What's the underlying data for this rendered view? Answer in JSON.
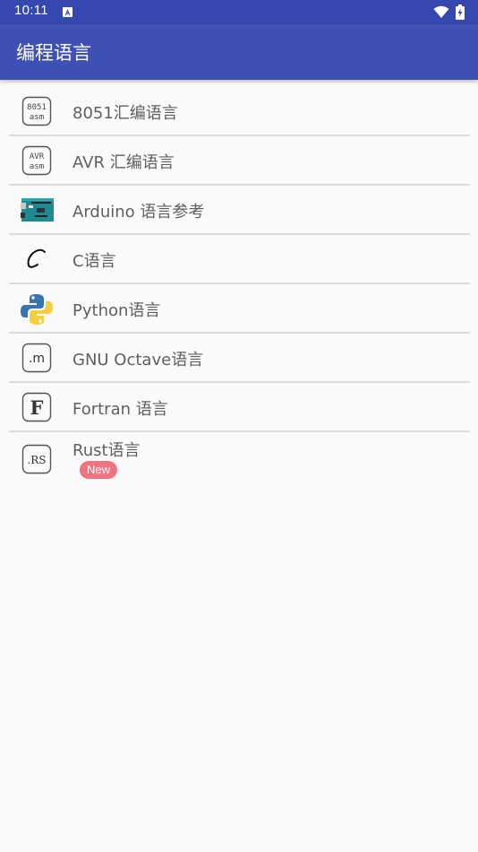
{
  "status_bar": {
    "time": "10:11",
    "notification_icon": "a-letter-icon",
    "wifi_icon": "wifi-icon",
    "battery_icon": "battery-charging-icon"
  },
  "app_bar": {
    "title": "编程语言"
  },
  "colors": {
    "status_bar": "#3448b0",
    "app_bar": "#3f51b5",
    "background": "#fafafa",
    "badge": "#ef7381"
  },
  "languages": [
    {
      "label": "8051汇编语言",
      "icon": "asm-8051-icon",
      "icon_text": [
        "8051",
        "asm"
      ]
    },
    {
      "label": "AVR 汇编语言",
      "icon": "asm-avr-icon",
      "icon_text": [
        "AVR",
        "asm"
      ]
    },
    {
      "label": "Arduino 语言参考",
      "icon": "arduino-board-icon"
    },
    {
      "label": "C语言",
      "icon": "c-letter-icon"
    },
    {
      "label": "Python语言",
      "icon": "python-logo-icon"
    },
    {
      "label": "GNU Octave语言",
      "icon": "octave-m-icon",
      "icon_text": [
        ".m"
      ]
    },
    {
      "label": "Fortran 语言",
      "icon": "fortran-f-icon",
      "icon_text": [
        "F"
      ]
    },
    {
      "label": "Rust语言",
      "icon": "rust-rs-icon",
      "icon_text": [
        ".RS"
      ],
      "badge": "New"
    }
  ]
}
